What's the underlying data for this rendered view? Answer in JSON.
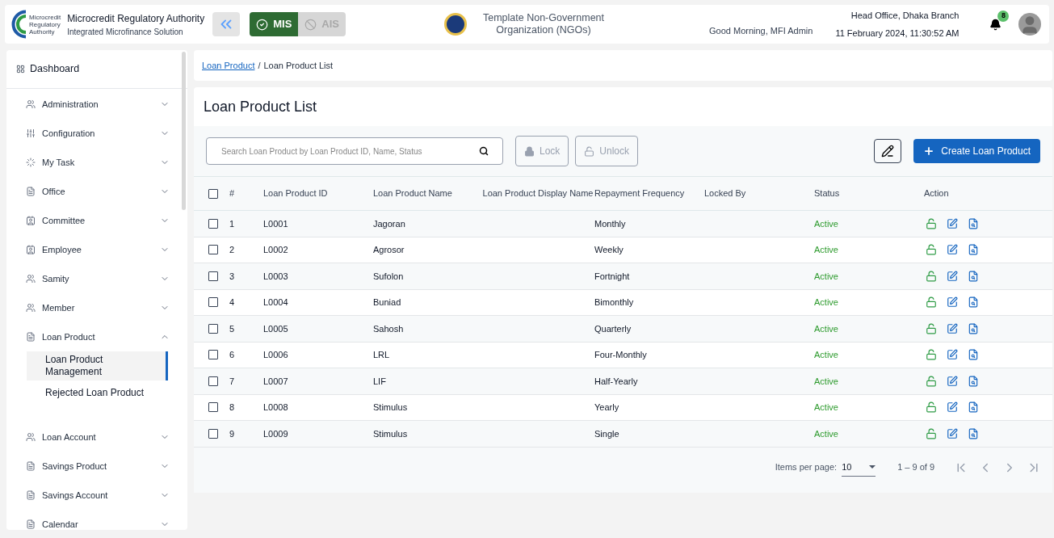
{
  "header": {
    "org_title": "Microcredit Regulatory Authority",
    "org_subtitle": "Integrated Microfinance Solution",
    "logo_text": [
      "Microcredit",
      "Regulatory",
      "Authority"
    ],
    "modes": [
      {
        "label": "MIS",
        "selected": true
      },
      {
        "label": "AIS",
        "selected": false
      }
    ],
    "tenant": "Template Non-Government Organization (NGOs)",
    "greeting": "Good Morning, MFI Admin",
    "branch": "Head Office, Dhaka Branch",
    "datetime": "11 February 2024, 11:30:52 AM",
    "notification_count": "8"
  },
  "sidebar": {
    "dashboard": "Dashboard",
    "items": [
      {
        "label": "Administration",
        "expanded": false
      },
      {
        "label": "Configuration",
        "expanded": false
      },
      {
        "label": "My Task",
        "expanded": false
      },
      {
        "label": "Office",
        "expanded": false
      },
      {
        "label": "Committee",
        "expanded": false
      },
      {
        "label": "Employee",
        "expanded": false
      },
      {
        "label": "Samity",
        "expanded": false
      },
      {
        "label": "Member",
        "expanded": false
      },
      {
        "label": "Loan Product",
        "expanded": true,
        "children": [
          {
            "label": "Loan Product Management",
            "selected": true
          },
          {
            "label": "Rejected Loan Product",
            "selected": false
          }
        ]
      },
      {
        "label": "Loan Account",
        "expanded": false
      },
      {
        "label": "Savings Product",
        "expanded": false
      },
      {
        "label": "Savings Account",
        "expanded": false
      },
      {
        "label": "Calendar",
        "expanded": false
      }
    ]
  },
  "breadcrumb": {
    "link": "Loan Product",
    "separator": "/",
    "current": "Loan Product List"
  },
  "page_title": "Loan Product List",
  "toolbar": {
    "search_placeholder": "Search Loan Product by Loan Product ID, Name, Status",
    "lock": "Lock",
    "unlock": "Unlock",
    "lock_disabled": true,
    "unlock_disabled": true,
    "create": "Create Loan Product"
  },
  "table": {
    "select_all_checked": false,
    "columns": [
      "#",
      "Loan Product ID",
      "Loan Product Name",
      "Loan Product Display Name",
      "Repayment Frequency",
      "Locked By",
      "Status",
      "Action"
    ],
    "rows": [
      {
        "no": "1",
        "id": "L0001",
        "name": "Jagoran",
        "frequency": "Monthly",
        "status": "Active",
        "checked": false
      },
      {
        "no": "2",
        "id": "L0002",
        "name": "Agrosor",
        "frequency": "Weekly",
        "status": "Active",
        "checked": false
      },
      {
        "no": "3",
        "id": "L0003",
        "name": "Sufolon",
        "frequency": "Fortnight",
        "status": "Active",
        "checked": false
      },
      {
        "no": "4",
        "id": "L0004",
        "name": "Buniad",
        "frequency": "Bimonthly",
        "status": "Active",
        "checked": false
      },
      {
        "no": "5",
        "id": "L0005",
        "name": "Sahosh",
        "frequency": "Quarterly",
        "status": "Active",
        "checked": false
      },
      {
        "no": "6",
        "id": "L0006",
        "name": "LRL",
        "frequency": "Four-Monthly",
        "status": "Active",
        "checked": false
      },
      {
        "no": "7",
        "id": "L0007",
        "name": "LIF",
        "frequency": "Half-Yearly",
        "status": "Active",
        "checked": false
      },
      {
        "no": "8",
        "id": "L0008",
        "name": "Stimulus",
        "frequency": "Yearly",
        "status": "Active",
        "checked": false
      },
      {
        "no": "9",
        "id": "L0009",
        "name": "Stimulus",
        "frequency": "Single",
        "status": "Active",
        "checked": false
      }
    ]
  },
  "paginator": {
    "label": "Items per page:",
    "page_size": "10",
    "range": "1 – 9 of 9"
  }
}
